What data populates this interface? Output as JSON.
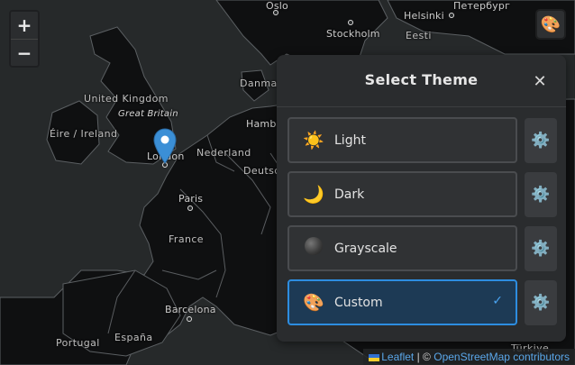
{
  "map": {
    "labels": {
      "oslo": "Oslo",
      "helsinki": "Helsinki",
      "st_petersburg": "Петербург",
      "stockholm": "Stockholm",
      "eesti": "Eesti",
      "danmark": "Danmar",
      "united_kingdom": "United Kingdom",
      "great_britain": "Great Britain",
      "eire": "Éire / Ireland",
      "london": "London",
      "nederland": "Nederland",
      "hamburg": "Hambu",
      "deutsch": "Deutsc",
      "paris": "Paris",
      "france": "France",
      "barcelona": "Barcelona",
      "portugal": "Portugal",
      "espana": "España",
      "turkiye": "Türkiye"
    }
  },
  "zoom": {
    "in_label": "+",
    "out_label": "−"
  },
  "theme_toggle": {
    "icon": "palette-icon",
    "glyph": "🎨"
  },
  "panel": {
    "title": "Select Theme",
    "close_label": "✕",
    "themes": [
      {
        "label": "Light",
        "icon": "sun-icon",
        "glyph": "☀️",
        "selected": false,
        "settings_glyph": "⚙️"
      },
      {
        "label": "Dark",
        "icon": "moon-icon",
        "glyph": "🌙",
        "selected": false,
        "settings_glyph": "⚙️"
      },
      {
        "label": "Grayscale",
        "icon": "grayscale-circle-icon",
        "glyph": "",
        "selected": false,
        "settings_glyph": "⚙️"
      },
      {
        "label": "Custom",
        "icon": "palette-icon",
        "glyph": "🎨",
        "selected": true,
        "settings_glyph": "⚙️",
        "check": "✓"
      }
    ],
    "accent_color": "#2d8de0"
  },
  "attribution": {
    "leaflet": "Leaflet",
    "separator": "| ©",
    "osm": "OpenStreetMap contributors"
  }
}
